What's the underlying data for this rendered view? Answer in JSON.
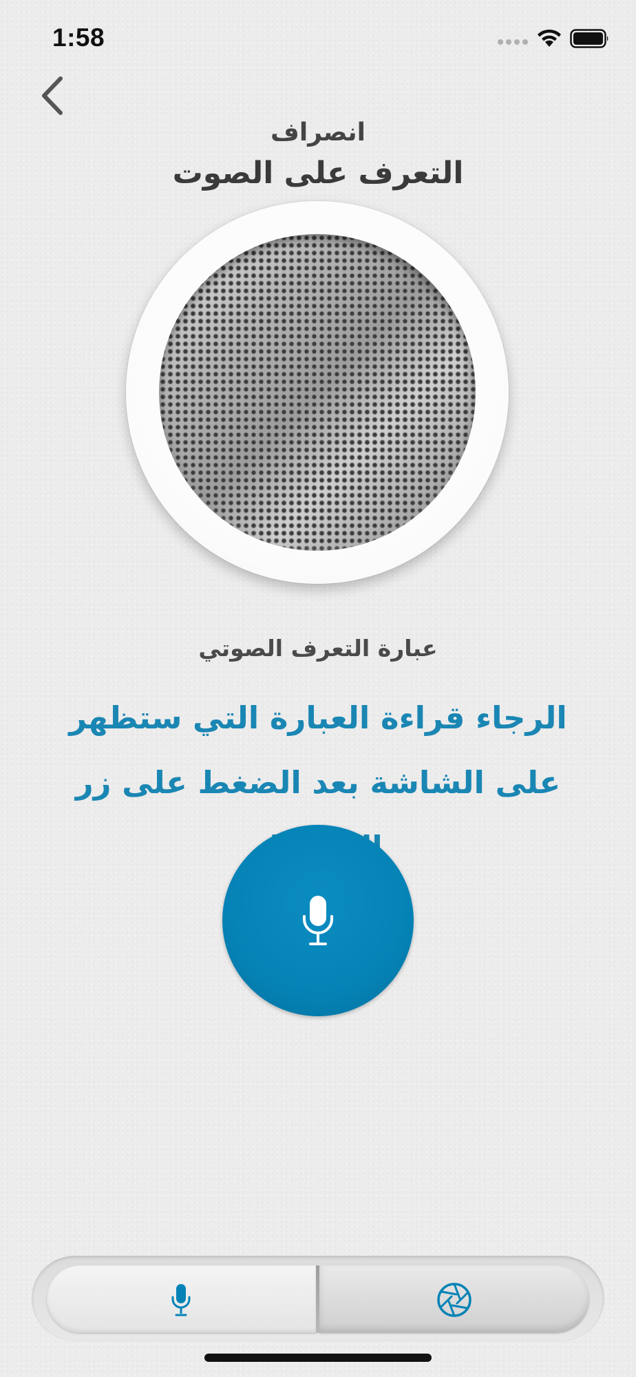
{
  "status_bar": {
    "time": "1:58"
  },
  "header": {
    "subtitle": "انصراف",
    "title": "التعرف على الصوت"
  },
  "phrase_section": {
    "label": "عبارة التعرف الصوتي",
    "instruction": "الرجاء قراءة العبارة التي ستظهر على الشاشة بعد الضغط على زر التسجيل"
  },
  "icons": {
    "back": "chevron-left-icon",
    "record": "microphone-icon",
    "voice_tab": "microphone-icon",
    "face_tab": "camera-aperture-icon"
  },
  "colors": {
    "accent": "#0583b6",
    "instruction_text": "#1a86b3",
    "background": "#ececec"
  },
  "segmented_control": {
    "selected": "voice"
  }
}
